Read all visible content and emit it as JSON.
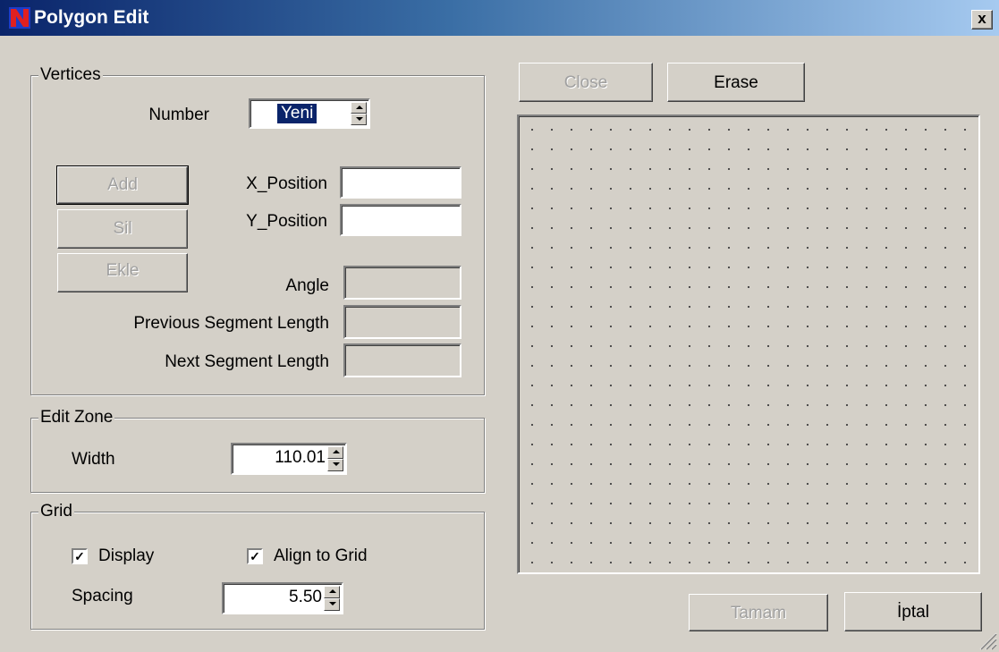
{
  "window": {
    "title": "Polygon Edit",
    "close_glyph": "x",
    "icon": "app-logo-icon"
  },
  "vertices": {
    "legend": "Vertices",
    "number_label": "Number",
    "number_value": "Yeni",
    "add_button": "Add",
    "sil_button": "Sil",
    "ekle_button": "Ekle",
    "x_label": "X_Position",
    "x_value": "",
    "y_label": "Y_Position",
    "y_value": "",
    "angle_label": "Angle",
    "prev_label": "Previous Segment Length",
    "next_label": "Next Segment Length"
  },
  "edit_zone": {
    "legend": "Edit Zone",
    "width_label": "Width",
    "width_value": "110.01"
  },
  "grid": {
    "legend": "Grid",
    "display_label": "Display",
    "display_checked": true,
    "align_label": "Align to Grid",
    "align_checked": true,
    "spacing_label": "Spacing",
    "spacing_value": "5.50"
  },
  "toolbar": {
    "close_button": "Close",
    "erase_button": "Erase"
  },
  "footer": {
    "ok_button": "Tamam",
    "cancel_button": "İptal"
  },
  "colors": {
    "face": "#d4d0c8",
    "title_start": "#0a246a",
    "title_end": "#a6caf0",
    "selection": "#0a246a"
  }
}
